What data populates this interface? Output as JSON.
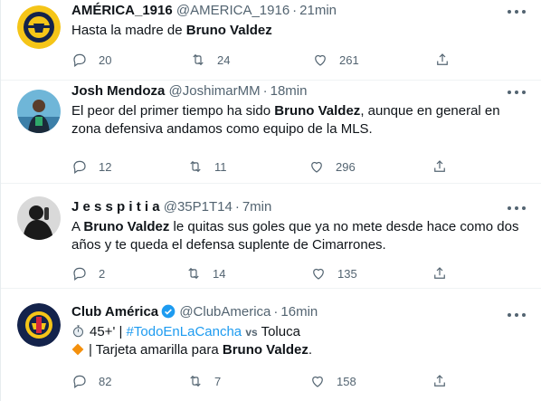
{
  "tweets": [
    {
      "name": "AMÉRICA_1916",
      "handle": "@AMERICA_1916",
      "time": "21min",
      "text_pre": "Hasta la madre de ",
      "text_bold": "Bruno Valdez",
      "replies": "20",
      "retweets": "24",
      "likes": "261",
      "avatar": "america-1916-crest"
    },
    {
      "name": "Josh Mendoza",
      "handle": "@JoshimarMM",
      "time": "18min",
      "text_pre": "El peor del primer tiempo ha sido ",
      "text_bold": "Bruno Valdez",
      "text_post": ", aunque en general en zona defensiva andamos como equipo de la MLS.",
      "replies": "12",
      "retweets": "11",
      "likes": "296",
      "avatar": "profile-photo"
    },
    {
      "name": "J e s s p i t i a",
      "handle": "@35P1T14",
      "time": "7min",
      "text_pre": "A ",
      "text_bold": "Bruno Valdez",
      "text_post": " le quitas sus goles que ya no mete desde hace como dos años y te queda el defensa suplente de Cimarrones.",
      "replies": "2",
      "retweets": "14",
      "likes": "135",
      "avatar": "silhouette-photo"
    },
    {
      "name": "Club América",
      "handle": "@ClubAmerica",
      "time": "16min",
      "line1_minute": "45+' | ",
      "line1_hashtag": "#TodoEnLaCancha",
      "line1_vs": "vs",
      "line1_rival": "Toluca",
      "line2_pre": "| Tarjeta amarilla para ",
      "line2_bold": "Bruno Valdez",
      "line2_post": ".",
      "replies": "82",
      "retweets": "7",
      "likes": "158",
      "avatar": "club-america-crest"
    }
  ],
  "colors": {
    "text": "#0f1419",
    "secondary": "#536471",
    "link": "#1d9bf0",
    "verified": "#1d9bf0",
    "divider": "#eff3f4",
    "crest_yellow": "#f5c518",
    "crest_navy": "#14234b"
  }
}
